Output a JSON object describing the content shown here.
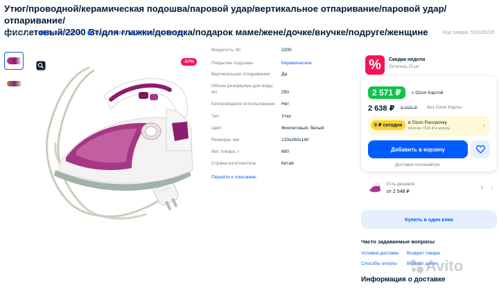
{
  "product": {
    "title": "Утюг/проводной/керамическая подошва/паровой удар/вертикальное отпаривание/паровой удар/отпаривание/фиолетовый/2200 Вт/для глажки/доводка/подарок маме/жене/дочке/внучке/подруге/женщине",
    "title_line1": "Утюг/проводной/керамическая подошва/паровой удар/вертикальное отпаривание/паровой удар/отпаривание/",
    "title_line2": "фиолетовый/2200 Вт/для глажки/доводка/подарок маме/жене/дочке/внучке/подруге/женщине",
    "stars": "★★★★★",
    "actions": {
      "review": "Оставить отзыв",
      "question": "Задать вопрос",
      "compare": "Добавить к сравнению"
    },
    "code": "Код товара: 520195220",
    "discount_badge": "-57%"
  },
  "specs": [
    {
      "label": "Мощность, Вт",
      "value": "2200",
      "link": false
    },
    {
      "label": "Покрытие подошвы",
      "value": "Керамическое",
      "link": true
    },
    {
      "label": "Вертикальное отпаривание",
      "value": "Да",
      "link": false
    },
    {
      "label": "Объем резервуара для воды, мл",
      "value": "250",
      "link": false
    },
    {
      "label": "Беспроводное использование",
      "value": "Нет",
      "link": false
    },
    {
      "label": "Тип",
      "value": "Утюг",
      "link": false
    },
    {
      "label": "Цвет",
      "value": "Фиолетовый, белый",
      "link": false
    },
    {
      "label": "Размеры, мм",
      "value": "120x260x140",
      "link": false
    },
    {
      "label": "Вес товара, г",
      "value": "680",
      "link": false
    },
    {
      "label": "Страна-изготовитель",
      "value": "Китай",
      "link": false
    }
  ],
  "description_link": "Перейти к описанию",
  "weekly": {
    "icon": "%",
    "title": "Скидки недели",
    "subtitle": "Осталось 23 шт"
  },
  "price": {
    "ozon_card_price": "2 571 ₽",
    "ozon_card_label": "с Ozon Картой",
    "regular_price": "2 638 ₽",
    "old_price": "6 000 ₽",
    "no_card_label": "без Ozon Карты",
    "installment_pill": "0 ₽ сегодня",
    "installment_title": "в Ozon Рассрочку",
    "installment_sub": "платеж ≈516 ₽ в месяц",
    "cart_button": "Добавить в корзину",
    "delivery_note": "Доставка послезавтра"
  },
  "cheaper": {
    "label": "Есть дешевле",
    "price": "от 2 548 ₽",
    "count": "1"
  },
  "one_click": "Купить в один клик",
  "faq": {
    "title": "Часто задаваемые вопросы",
    "links": [
      "Условия доставки",
      "Возврат товара",
      "Способы оплаты",
      "Возврат денег"
    ]
  },
  "delivery_info_title": "Информация о доставке",
  "watermark": "Avito",
  "colors": {
    "accent": "#005bff",
    "green": "#10c44c",
    "pink": "#f91155",
    "purple": "#8e1c6e"
  },
  "icons": {
    "scan": "scan-magnify-icon",
    "heart": "heart-icon",
    "chevron": "chevron-right-icon"
  }
}
